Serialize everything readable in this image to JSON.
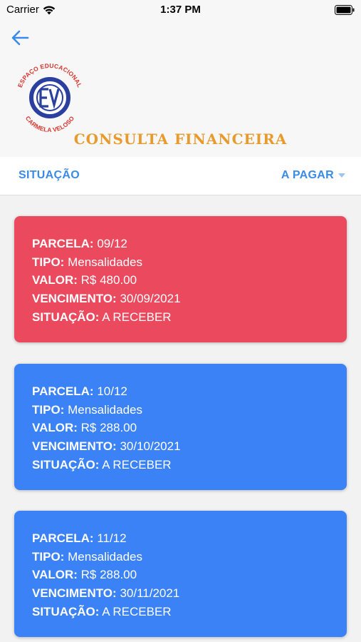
{
  "status_bar": {
    "carrier": "Carrier",
    "time": "1:37 PM"
  },
  "header": {
    "back_icon": "arrow-left-icon",
    "logo": {
      "top_text": "ESPAÇO EDUCACIONAL",
      "bottom_text": "CARMELA VELOSO",
      "initials": "ECV"
    },
    "title": "CONSULTA FINANCEIRA"
  },
  "filter": {
    "label": "SITUAÇÃO",
    "value": "A PAGAR"
  },
  "labels": {
    "parcela": "PARCELA:",
    "tipo": "TIPO:",
    "valor": "VALOR:",
    "vencimento": "VENCIMENTO:",
    "situacao": "SITUAÇÃO:"
  },
  "cards": [
    {
      "parcela": "09/12",
      "tipo": "Mensalidades",
      "valor": "R$ 480.00",
      "vencimento": "30/09/2021",
      "situacao": "A RECEBER",
      "color": "#eb4a5e"
    },
    {
      "parcela": "10/12",
      "tipo": "Mensalidades",
      "valor": "R$ 288.00",
      "vencimento": "30/10/2021",
      "situacao": "A RECEBER",
      "color": "#3b82f6"
    },
    {
      "parcela": "11/12",
      "tipo": "Mensalidades",
      "valor": "R$ 288.00",
      "vencimento": "30/11/2021",
      "situacao": "A RECEBER",
      "color": "#3b82f6"
    }
  ],
  "colors": {
    "accent": "#3a8be6",
    "title": "#e89a2c",
    "logo_blue": "#2a3f9e",
    "logo_red": "#d8342c"
  }
}
